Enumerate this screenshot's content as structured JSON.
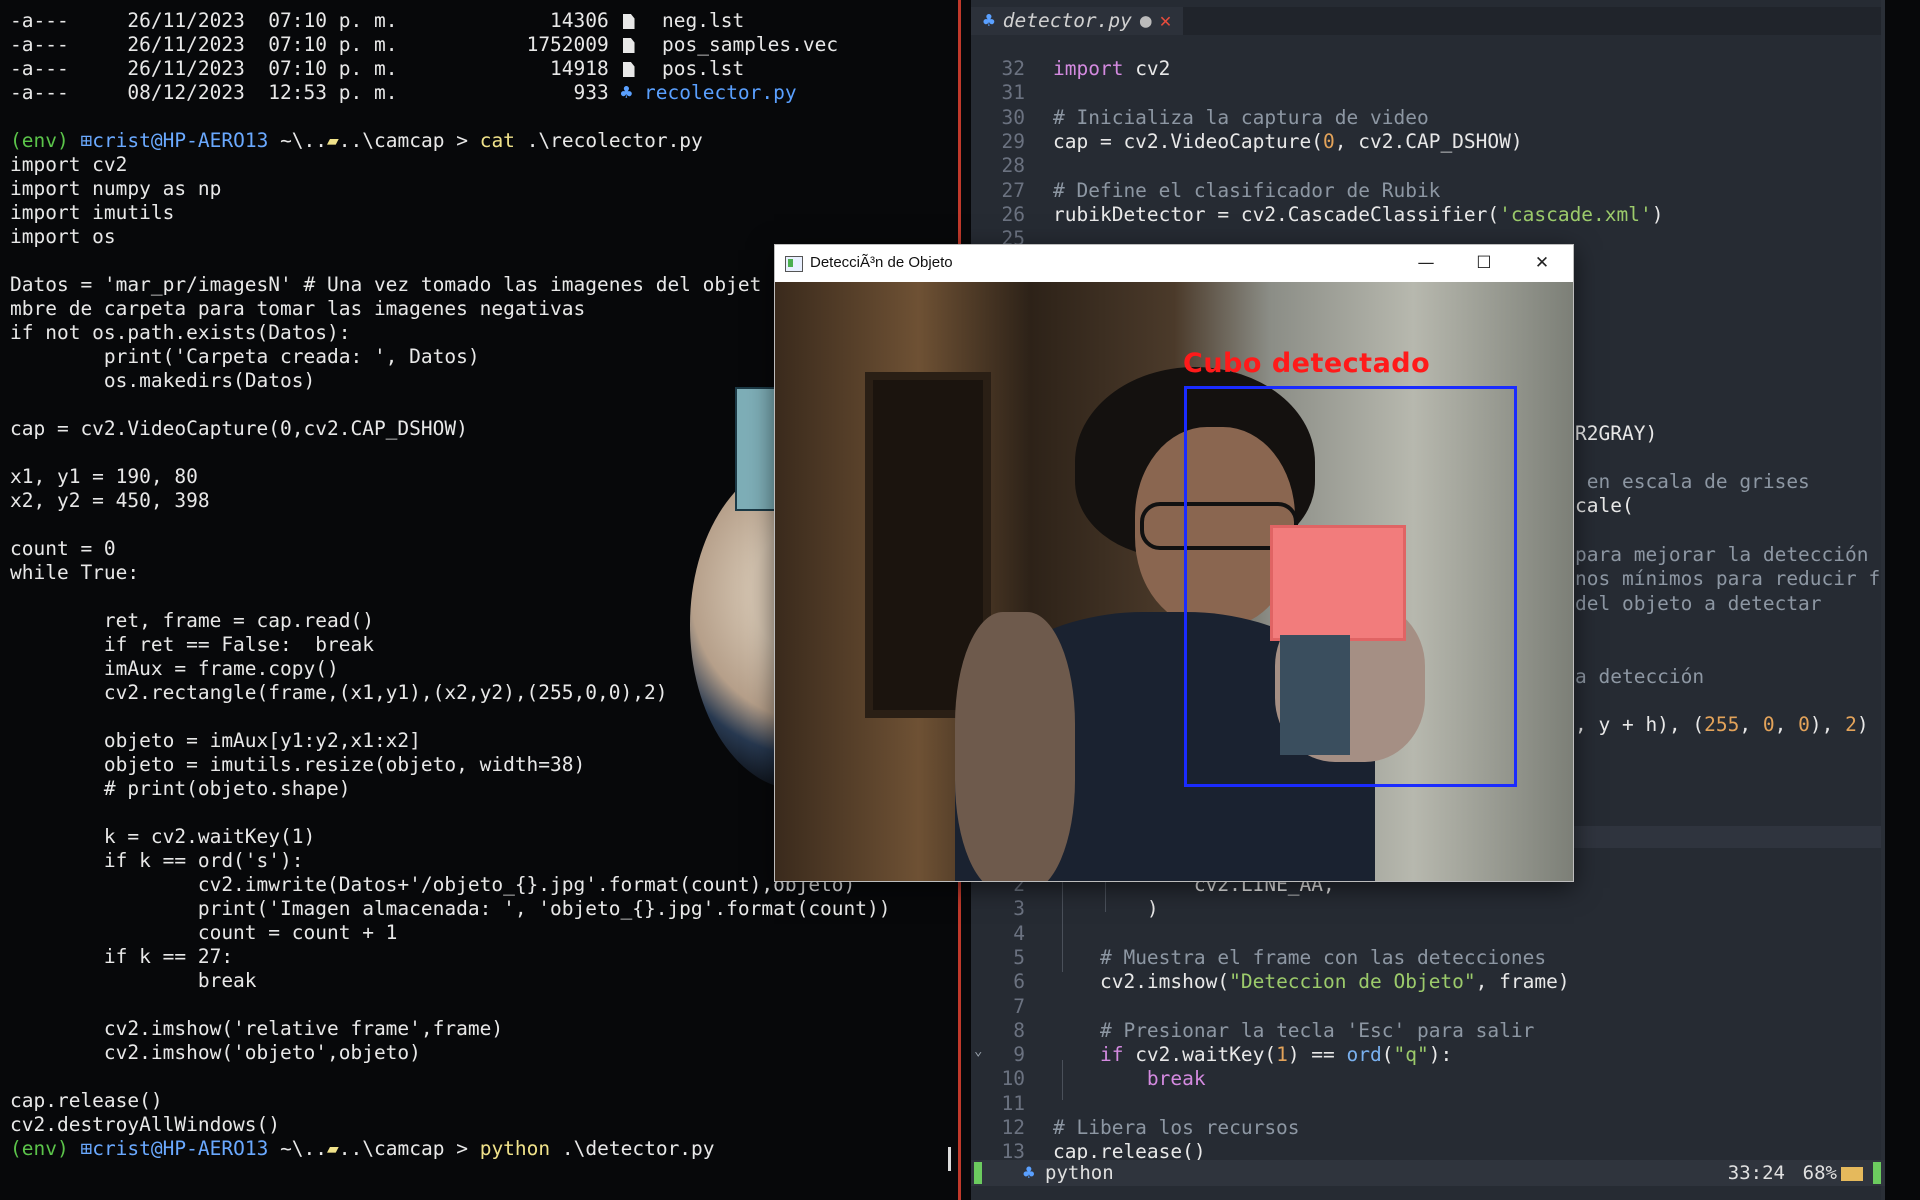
{
  "terminal": {
    "listing": [
      {
        "mode": "-a---",
        "date": "26/11/2023",
        "time": "07:10 p. m.",
        "size": "14306",
        "icon": "file-icon",
        "name": "neg.lst"
      },
      {
        "mode": "-a---",
        "date": "26/11/2023",
        "time": "07:10 p. m.",
        "size": "1752009",
        "icon": "file-icon",
        "name": "pos_samples.vec"
      },
      {
        "mode": "-a---",
        "date": "26/11/2023",
        "time": "07:10 p. m.",
        "size": "14918",
        "icon": "file-icon",
        "name": "pos.lst"
      },
      {
        "mode": "-a---",
        "date": "08/12/2023",
        "time": "12:53 p. m.",
        "size": "933",
        "icon": "python-icon",
        "name": "recolector.py"
      }
    ],
    "prompt1": {
      "env": "(env)",
      "user": "crist@HP-AERO13",
      "path1": "~\\..",
      "path2": "..\\camcap",
      "arrow": ">",
      "cmd": "cat",
      "arg": ".\\recolector.py"
    },
    "code": [
      "import cv2",
      "import numpy as np",
      "import imutils",
      "import os",
      "",
      "Datos = 'mar_pr/imagesN' # Una vez tomado las imagenes del objet",
      "mbre de carpeta para tomar las imagenes negativas",
      "if not os.path.exists(Datos):",
      "        print('Carpeta creada: ', Datos)",
      "        os.makedirs(Datos)",
      "",
      "cap = cv2.VideoCapture(0,cv2.CAP_DSHOW)",
      "",
      "x1, y1 = 190, 80",
      "x2, y2 = 450, 398",
      "",
      "count = 0",
      "while True:",
      "",
      "        ret, frame = cap.read()",
      "        if ret == False:  break",
      "        imAux = frame.copy()",
      "        cv2.rectangle(frame,(x1,y1),(x2,y2),(255,0,0),2)",
      "",
      "        objeto = imAux[y1:y2,x1:x2]",
      "        objeto = imutils.resize(objeto, width=38)",
      "        # print(objeto.shape)",
      "",
      "        k = cv2.waitKey(1)",
      "        if k == ord('s'):",
      "                cv2.imwrite(Datos+'/objeto_{}.jpg'.format(count),objeto)",
      "                print('Imagen almacenada: ', 'objeto_{}.jpg'.format(count))",
      "                count = count + 1",
      "        if k == 27:",
      "                break",
      "",
      "        cv2.imshow('relative frame',frame)",
      "        cv2.imshow('objeto',objeto)",
      "",
      "cap.release()",
      "cv2.destroyAllWindows()"
    ],
    "prompt2": {
      "env": "(env)",
      "user": "crist@HP-AERO13",
      "path1": "~\\..",
      "path2": "..\\camcap",
      "arrow": ">",
      "cmd": "python",
      "arg": ".\\detector.py"
    }
  },
  "editor": {
    "tab": {
      "icon": "python-icon",
      "label": "detector.py",
      "modified": "●",
      "close": "✕"
    },
    "top_lines": [
      {
        "n": "32",
        "parts": [
          [
            "kw",
            "import"
          ],
          [
            "t",
            " cv2"
          ]
        ]
      },
      {
        "n": "31",
        "parts": []
      },
      {
        "n": "30",
        "parts": [
          [
            "cm",
            "# Inicializa la captura de video"
          ]
        ]
      },
      {
        "n": "29",
        "parts": [
          [
            "t",
            "cap = cv2.VideoCapture("
          ],
          [
            "num",
            "0"
          ],
          [
            "t",
            ", cv2.CAP_DSHOW)"
          ]
        ]
      },
      {
        "n": "28",
        "parts": []
      },
      {
        "n": "27",
        "parts": [
          [
            "cm",
            "# Define el clasificador de Rubik"
          ]
        ]
      },
      {
        "n": "26",
        "parts": [
          [
            "t",
            "rubikDetector = cv2.CascadeClassifier("
          ],
          [
            "str",
            "'cascade.xml'"
          ],
          [
            "t",
            ")"
          ]
        ]
      },
      {
        "n": "25",
        "parts": []
      }
    ],
    "right_fragments": [
      {
        "row": 15,
        "parts": [
          [
            "t",
            "R2GRAY)"
          ]
        ]
      },
      {
        "row": 17,
        "parts": [
          [
            "cm",
            " en escala de grises"
          ]
        ]
      },
      {
        "row": 18,
        "parts": [
          [
            "t",
            "cale("
          ]
        ]
      },
      {
        "row": 20,
        "parts": [
          [
            "cm",
            "para mejorar la detección"
          ]
        ]
      },
      {
        "row": 21,
        "parts": [
          [
            "cm",
            "nos mínimos para reducir f"
          ]
        ]
      },
      {
        "row": 22,
        "parts": [
          [
            "cm",
            "del objeto a detectar"
          ]
        ]
      },
      {
        "row": 25,
        "parts": [
          [
            "cm",
            "a detección"
          ]
        ]
      },
      {
        "row": 27,
        "parts": [
          [
            "t",
            ", y + h), ("
          ],
          [
            "num",
            "255"
          ],
          [
            "t",
            ", "
          ],
          [
            "num",
            "0"
          ],
          [
            "t",
            ", "
          ],
          [
            "num",
            "0"
          ],
          [
            "t",
            "), "
          ],
          [
            "num",
            "2"
          ],
          [
            "t",
            ")"
          ]
        ]
      }
    ],
    "bottom_lines": [
      {
        "n": "2",
        "indent": "            ",
        "parts": [
          [
            "t",
            "cv2.LINE_AA,"
          ]
        ]
      },
      {
        "n": "3",
        "indent": "        ",
        "parts": [
          [
            "t",
            ")"
          ]
        ]
      },
      {
        "n": "4",
        "indent": "",
        "parts": []
      },
      {
        "n": "5",
        "indent": "    ",
        "parts": [
          [
            "cm",
            "# Muestra el frame con las detecciones"
          ]
        ]
      },
      {
        "n": "6",
        "indent": "    ",
        "parts": [
          [
            "t",
            "cv2.imshow("
          ],
          [
            "str",
            "\"Deteccion de Objeto\""
          ],
          [
            "t",
            ", frame)"
          ]
        ]
      },
      {
        "n": "7",
        "indent": "",
        "parts": []
      },
      {
        "n": "8",
        "indent": "    ",
        "parts": [
          [
            "cm",
            "# Presionar la tecla 'Esc' para salir"
          ]
        ]
      },
      {
        "n": "9",
        "indent": "    ",
        "parts": [
          [
            "kw",
            "if"
          ],
          [
            "t",
            " cv2.waitKey("
          ],
          [
            "num",
            "1"
          ],
          [
            "t",
            ") == "
          ],
          [
            "fn",
            "ord"
          ],
          [
            "t",
            "("
          ],
          [
            "str",
            "\"q\""
          ],
          [
            "t",
            "):"
          ]
        ]
      },
      {
        "n": "10",
        "indent": "        ",
        "parts": [
          [
            "kw",
            "break"
          ]
        ]
      },
      {
        "n": "11",
        "indent": "",
        "parts": []
      },
      {
        "n": "12",
        "indent": "",
        "parts": [
          [
            "cm",
            "# Libera los recursos"
          ]
        ]
      },
      {
        "n": "13",
        "indent": "",
        "parts": [
          [
            "t",
            "cap.release()"
          ]
        ]
      }
    ],
    "status": {
      "lang": "python",
      "position": "33:24",
      "percent": "68%"
    }
  },
  "camera_window": {
    "title": "DetecciÃ³n de Objeto",
    "min_glyph": "—",
    "max_glyph": "☐",
    "close_glyph": "✕",
    "detection_label": "Cubo detectado"
  },
  "colors": {
    "accent_red": "#ff1a1a",
    "box_blue": "#1a2bff",
    "env_green": "#5bc44a",
    "user_blue": "#6aa9ff",
    "cmd_yellow": "#f0e28a"
  }
}
